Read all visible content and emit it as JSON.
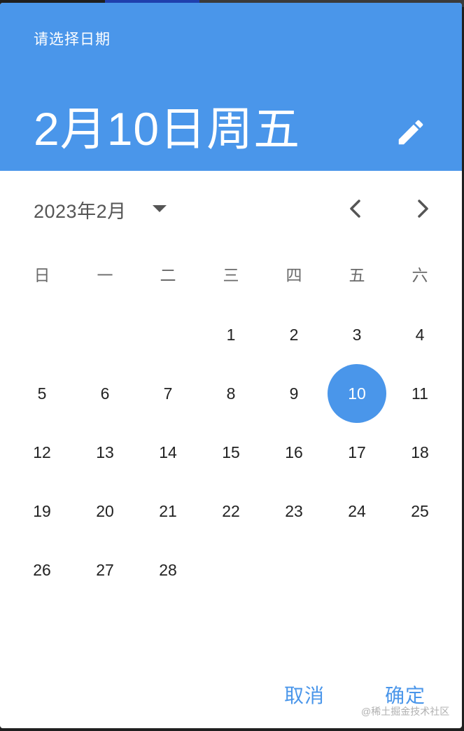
{
  "header": {
    "help_text": "请选择日期",
    "headline": "2月10日周五",
    "edit_icon": "pencil-icon"
  },
  "month_nav": {
    "label": "2023年2月",
    "dropdown_icon": "caret-down-icon",
    "prev_icon": "chevron-left-icon",
    "next_icon": "chevron-right-icon"
  },
  "weekdays": [
    "日",
    "一",
    "二",
    "三",
    "四",
    "五",
    "六"
  ],
  "days": [
    "",
    "",
    "",
    "1",
    "2",
    "3",
    "4",
    "5",
    "6",
    "7",
    "8",
    "9",
    "10",
    "11",
    "12",
    "13",
    "14",
    "15",
    "16",
    "17",
    "18",
    "19",
    "20",
    "21",
    "22",
    "23",
    "24",
    "25",
    "26",
    "27",
    "28",
    "",
    "",
    "",
    ""
  ],
  "selected_day": "10",
  "actions": {
    "cancel": "取消",
    "ok": "确定"
  },
  "watermark": "@稀土掘金技术社区",
  "colors": {
    "accent": "#4a96ea"
  }
}
